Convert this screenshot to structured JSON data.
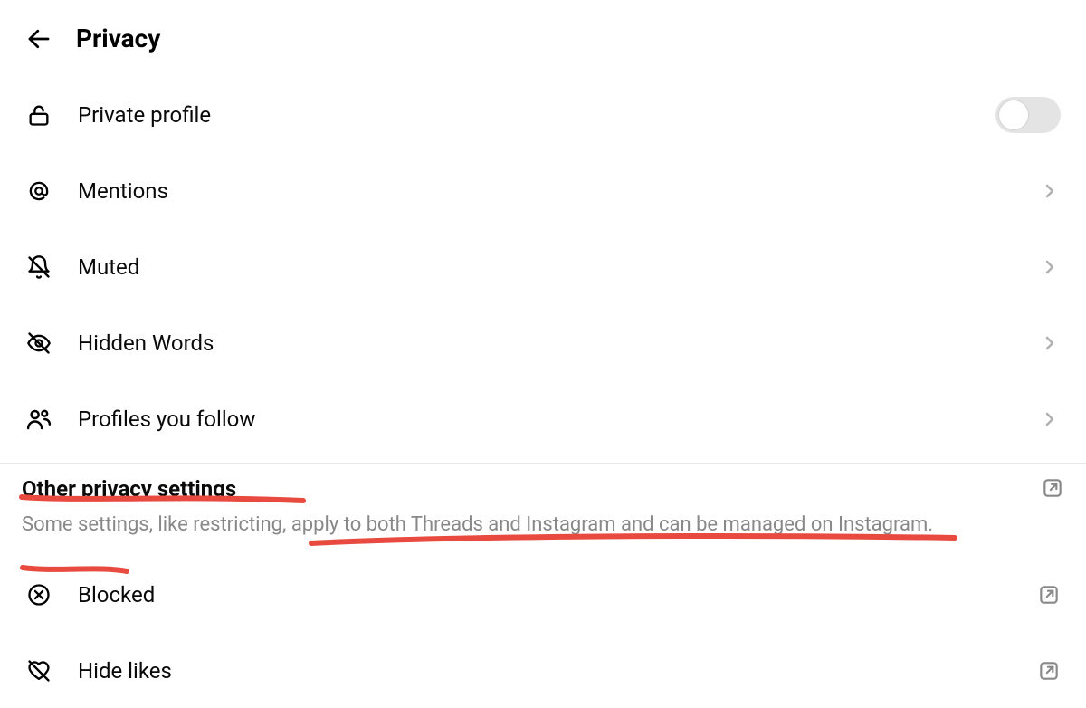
{
  "header": {
    "title": "Privacy"
  },
  "items": {
    "private_profile": "Private profile",
    "mentions": "Mentions",
    "muted": "Muted",
    "hidden_words": "Hidden Words",
    "profiles_you_follow": "Profiles you follow",
    "blocked": "Blocked",
    "hide_likes": "Hide likes"
  },
  "section": {
    "heading": "Other privacy settings",
    "subtext": "Some settings, like restricting, apply to both Threads and Instagram and can be managed on Instagram."
  },
  "private_profile_on": false
}
